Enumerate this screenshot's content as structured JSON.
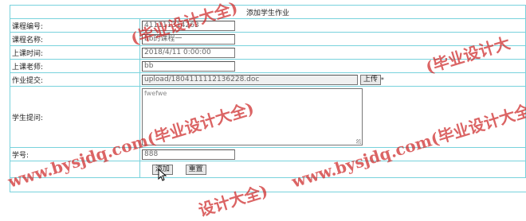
{
  "form": {
    "title": "添加学生作业",
    "fields": [
      {
        "label": "课程编号:",
        "value": "411111314263"
      },
      {
        "label": "课程名称:",
        "value": "bb的课程一"
      },
      {
        "label": "上课时间:",
        "value": "2018/4/11 0:00:00"
      },
      {
        "label": "上课老师:",
        "value": "bb"
      }
    ],
    "upload": {
      "label": "作业提交:",
      "value": "upload/1804111112136228.doc",
      "button": "上传",
      "required_mark": "*"
    },
    "question": {
      "label": "学生提问:",
      "value": "fwefwe"
    },
    "student": {
      "label": "学号:",
      "value": "888"
    },
    "buttons": {
      "submit": "添加",
      "reset": "重置"
    }
  },
  "watermark": {
    "text_a": "www.bysjdq.com(毕业设计大全)",
    "text_b": "www.bysjdq.com(毕业设计大全)",
    "text_c": "(毕业设计大全)",
    "text_d": "(毕业设计大",
    "text_e": "设计大全)",
    "color": "#cd2828"
  },
  "colors": {
    "border": "#78d2dc"
  }
}
